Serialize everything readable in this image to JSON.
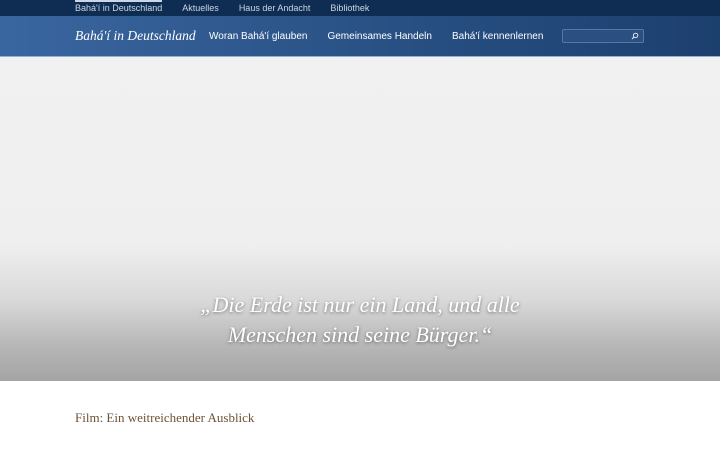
{
  "topnav": {
    "items": [
      {
        "label": "Bahá'í in Deutschland"
      },
      {
        "label": "Aktuelles"
      },
      {
        "label": "Haus der Andacht"
      },
      {
        "label": "Bibliothek"
      }
    ]
  },
  "header": {
    "brand": "Bahá'í in Deutschland",
    "nav": [
      {
        "label": "Woran Bahá'í glauben"
      },
      {
        "label": "Gemeinsames Handeln"
      },
      {
        "label": "Bahá'í kennenlernen"
      }
    ],
    "search": {
      "placeholder": "",
      "value": ""
    },
    "colors": {
      "topbar": "#0f2d52",
      "header": "#2b5488"
    }
  },
  "hero": {
    "quote_line1": "„Die Erde ist nur ein Land, und alle",
    "quote_line2": "Menschen sind seine Bürger.“"
  },
  "content": {
    "film_title": "Film: Ein weitreichender Ausblick",
    "title_color": "#6b5434"
  }
}
